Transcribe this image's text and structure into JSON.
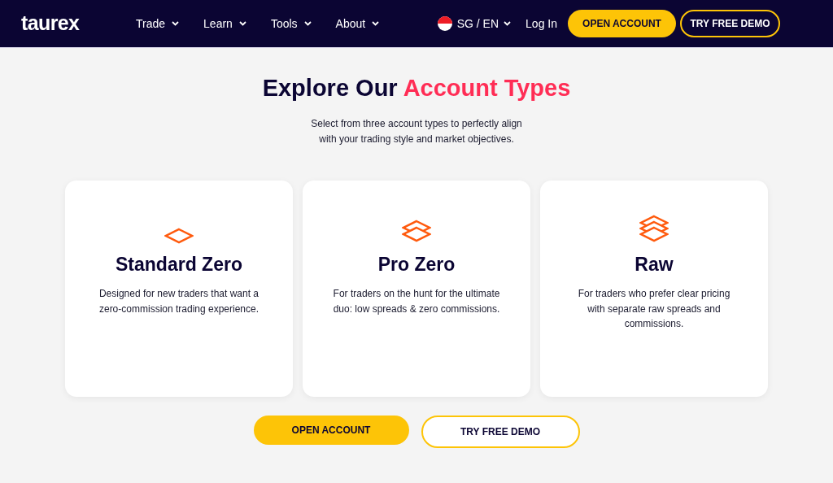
{
  "header": {
    "logo": "taurex",
    "nav": [
      {
        "label": "Trade"
      },
      {
        "label": "Learn"
      },
      {
        "label": "Tools"
      },
      {
        "label": "About"
      }
    ],
    "locale": "SG / EN",
    "login": "Log In",
    "open_account": "OPEN ACCOUNT",
    "try_demo": "TRY FREE DEMO"
  },
  "hero": {
    "title_start": "Explore Our",
    "title_accent": "Account Types",
    "subtitle_lines": [
      "Select from three account types to perfectly align",
      "with your trading style and market objectives."
    ]
  },
  "cards": [
    {
      "kind": "single",
      "title": "Standard Zero",
      "description": "Designed for new traders that want a zero-commission trading experience."
    },
    {
      "kind": "double",
      "title": "Pro Zero",
      "description": "For traders on the hunt for the ultimate duo: low spreads & zero commissions."
    },
    {
      "kind": "triple",
      "title": "Raw",
      "description": "For traders who prefer clear pricing with separate raw spreads and commissions."
    }
  ],
  "actions": {
    "open_account": "OPEN ACCOUNT",
    "try_demo": "TRY FREE DEMO"
  }
}
